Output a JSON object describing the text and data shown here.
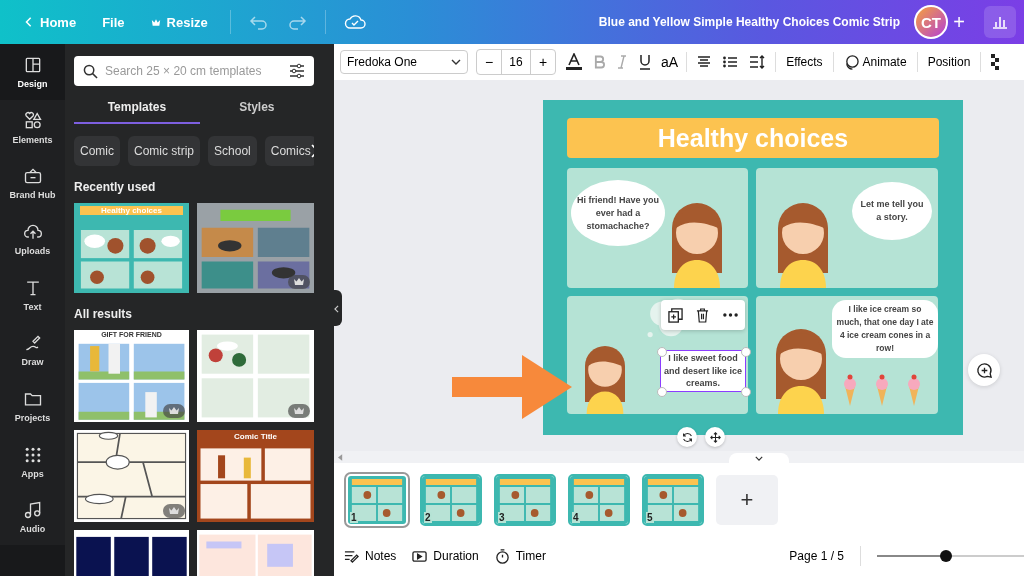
{
  "top_bar": {
    "back": "Home",
    "menu": [
      "File",
      "Resize"
    ],
    "title": "Blue and Yellow Simple Healthy Choices Comic Strip",
    "avatar": "CT",
    "add": "+"
  },
  "rail": [
    {
      "label": "Design",
      "selected": true
    },
    {
      "label": "Elements",
      "selected": false
    },
    {
      "label": "Brand Hub",
      "selected": false
    },
    {
      "label": "Uploads",
      "selected": false
    },
    {
      "label": "Text",
      "selected": false
    },
    {
      "label": "Draw",
      "selected": false
    },
    {
      "label": "Projects",
      "selected": false
    },
    {
      "label": "Apps",
      "selected": false
    },
    {
      "label": "Audio",
      "selected": false
    }
  ],
  "panel": {
    "search": {
      "placeholder": "Search 25 × 20 cm templates"
    },
    "tabs": [
      {
        "label": "Templates",
        "selected": true
      },
      {
        "label": "Styles",
        "selected": false
      }
    ],
    "chips": [
      "Comic",
      "Comic strip",
      "School",
      "Comics"
    ],
    "recent_heading": "Recently used",
    "recent": [
      {
        "kind": "teal",
        "title": "Healthy choices",
        "premium": false
      },
      {
        "kind": "collage",
        "premium": true
      }
    ],
    "results_heading": "All results",
    "results": [
      {
        "kind": "blue",
        "title": "GIFT FOR FRIEND",
        "premium": true
      },
      {
        "kind": "mint",
        "premium": true
      },
      {
        "kind": "blank",
        "premium": true
      },
      {
        "kind": "brown",
        "title": "Comic Title",
        "premium": false
      },
      {
        "kind": "navy",
        "premium": false
      },
      {
        "kind": "pastel",
        "premium": false
      }
    ]
  },
  "toolbar": {
    "font": "Fredoka One",
    "minus": "−",
    "size": "16",
    "plus": "+",
    "case": "aA",
    "buttons": [
      "Effects",
      "Animate",
      "Position"
    ]
  },
  "page": {
    "title": "Healthy choices",
    "panels": [
      {
        "kind": "bubble-left",
        "text": "Hi friend! Have you ever had a stomachache?",
        "selected": false
      },
      {
        "kind": "bubble-right",
        "text": "Let me tell you a story.",
        "selected": false
      },
      {
        "kind": "textbox",
        "text": "I like sweet food and desert like ice creams.",
        "selected": true
      },
      {
        "kind": "bubble-top",
        "text": "I like ice cream so much, that one day I ate 4 ice cream cones in a row!",
        "selected": false
      }
    ]
  },
  "pages": [
    {
      "number": "1",
      "selected": true
    },
    {
      "number": "2",
      "selected": false
    },
    {
      "number": "3",
      "selected": false
    },
    {
      "number": "4",
      "selected": false
    },
    {
      "number": "5",
      "selected": false
    }
  ],
  "add_page": "+",
  "footer": {
    "items": [
      "Notes",
      "Duration",
      "Timer"
    ],
    "page_indicator": "Page 1 / 5",
    "zoom": {
      "level": 0.47
    }
  }
}
